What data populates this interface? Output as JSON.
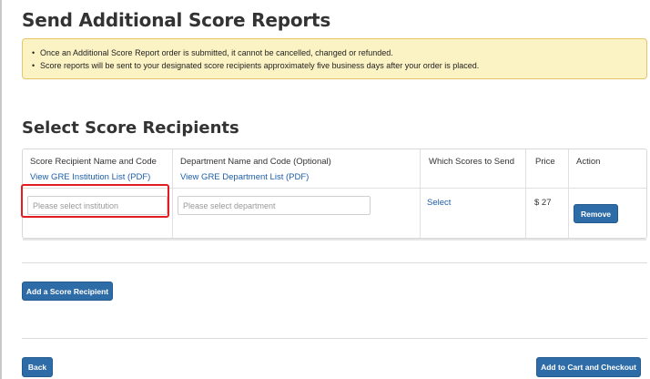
{
  "page": {
    "title": "Send Additional Score Reports"
  },
  "notice": {
    "items": [
      "Once an Additional Score Report order is submitted, it cannot be cancelled, changed or refunded.",
      "Score reports will be sent to your designated score recipients approximately five business days after your order is placed."
    ]
  },
  "recipients": {
    "title": "Select Score Recipients",
    "columns": {
      "recipient_header": "Score Recipient Name and Code",
      "recipient_link": "View GRE Institution List (PDF)",
      "department_header": "Department Name and Code (Optional)",
      "department_link": "View GRE Department List (PDF)",
      "scores_header": "Which Scores to Send",
      "price_header": "Price",
      "action_header": "Action"
    },
    "row": {
      "institution_placeholder": "Please select institution",
      "department_placeholder": "Please select department",
      "scores_link": "Select",
      "price": "$ 27",
      "remove_label": "Remove"
    },
    "add_label": "Add a Score Recipient"
  },
  "footer": {
    "back_label": "Back",
    "checkout_label": "Add to Cart and Checkout"
  },
  "colors": {
    "link": "#1d5ea8",
    "button": "#2e6ca8",
    "notice_bg": "#fcf3c4",
    "highlight": "#e31b23"
  }
}
